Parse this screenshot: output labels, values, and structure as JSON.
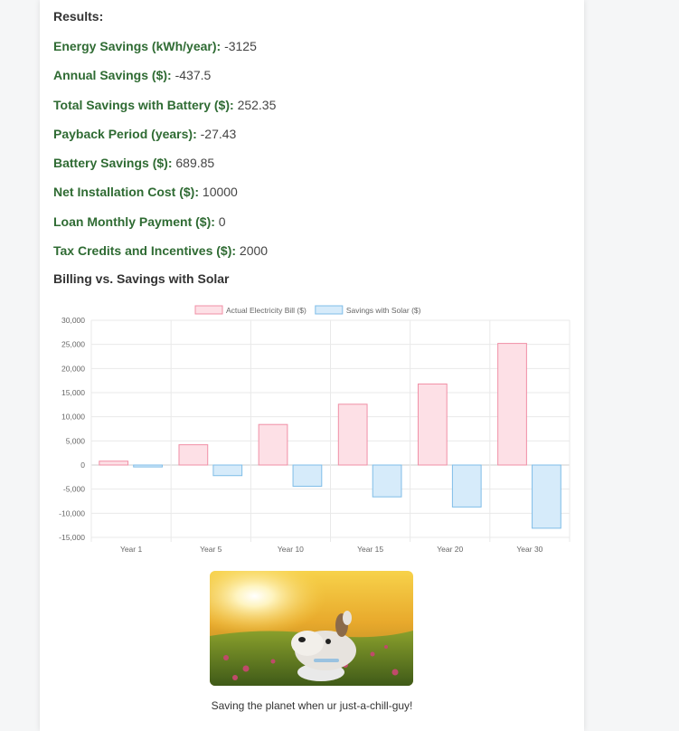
{
  "results": {
    "heading": "Results:",
    "items": [
      {
        "label": "Energy Savings (kWh/year):",
        "value": "-3125"
      },
      {
        "label": "Annual Savings ($):",
        "value": "-437.5"
      },
      {
        "label": "Total Savings with Battery ($):",
        "value": "252.35"
      },
      {
        "label": "Payback Period (years):",
        "value": "-27.43"
      },
      {
        "label": "Battery Savings ($):",
        "value": "689.85"
      },
      {
        "label": "Net Installation Cost ($):",
        "value": "10000"
      },
      {
        "label": "Loan Monthly Payment ($):",
        "value": "0"
      },
      {
        "label": "Tax Credits and Incentives ($):",
        "value": "2000"
      }
    ]
  },
  "chart_section": {
    "title": "Billing vs. Savings with Solar"
  },
  "chart_data": {
    "type": "bar",
    "categories": [
      "Year 1",
      "Year 5",
      "Year 10",
      "Year 15",
      "Year 20",
      "Year 30"
    ],
    "series": [
      {
        "name": "Actual Electricity Bill ($)",
        "values": [
          800,
          4200,
          8400,
          12600,
          16800,
          25200
        ],
        "fill": "#fde0e6",
        "stroke": "#f08fa6"
      },
      {
        "name": "Savings with Solar ($)",
        "values": [
          -400,
          -2200,
          -4400,
          -6600,
          -8700,
          -13100
        ],
        "fill": "#d6ebfa",
        "stroke": "#7fbde8"
      }
    ],
    "ylim": [
      -15000,
      30000
    ],
    "yticks": [
      "30,000",
      "25,000",
      "20,000",
      "15,000",
      "10,000",
      "5,000",
      "0",
      "-5,000",
      "-10,000",
      "-15,000"
    ],
    "ytick_values": [
      30000,
      25000,
      20000,
      15000,
      10000,
      5000,
      0,
      -5000,
      -10000,
      -15000
    ],
    "grid": true,
    "legend": "top"
  },
  "image": {
    "icon": "cartoon-dog-in-field-photo"
  },
  "caption": "Saving the planet when ur just-a-chill-guy!"
}
